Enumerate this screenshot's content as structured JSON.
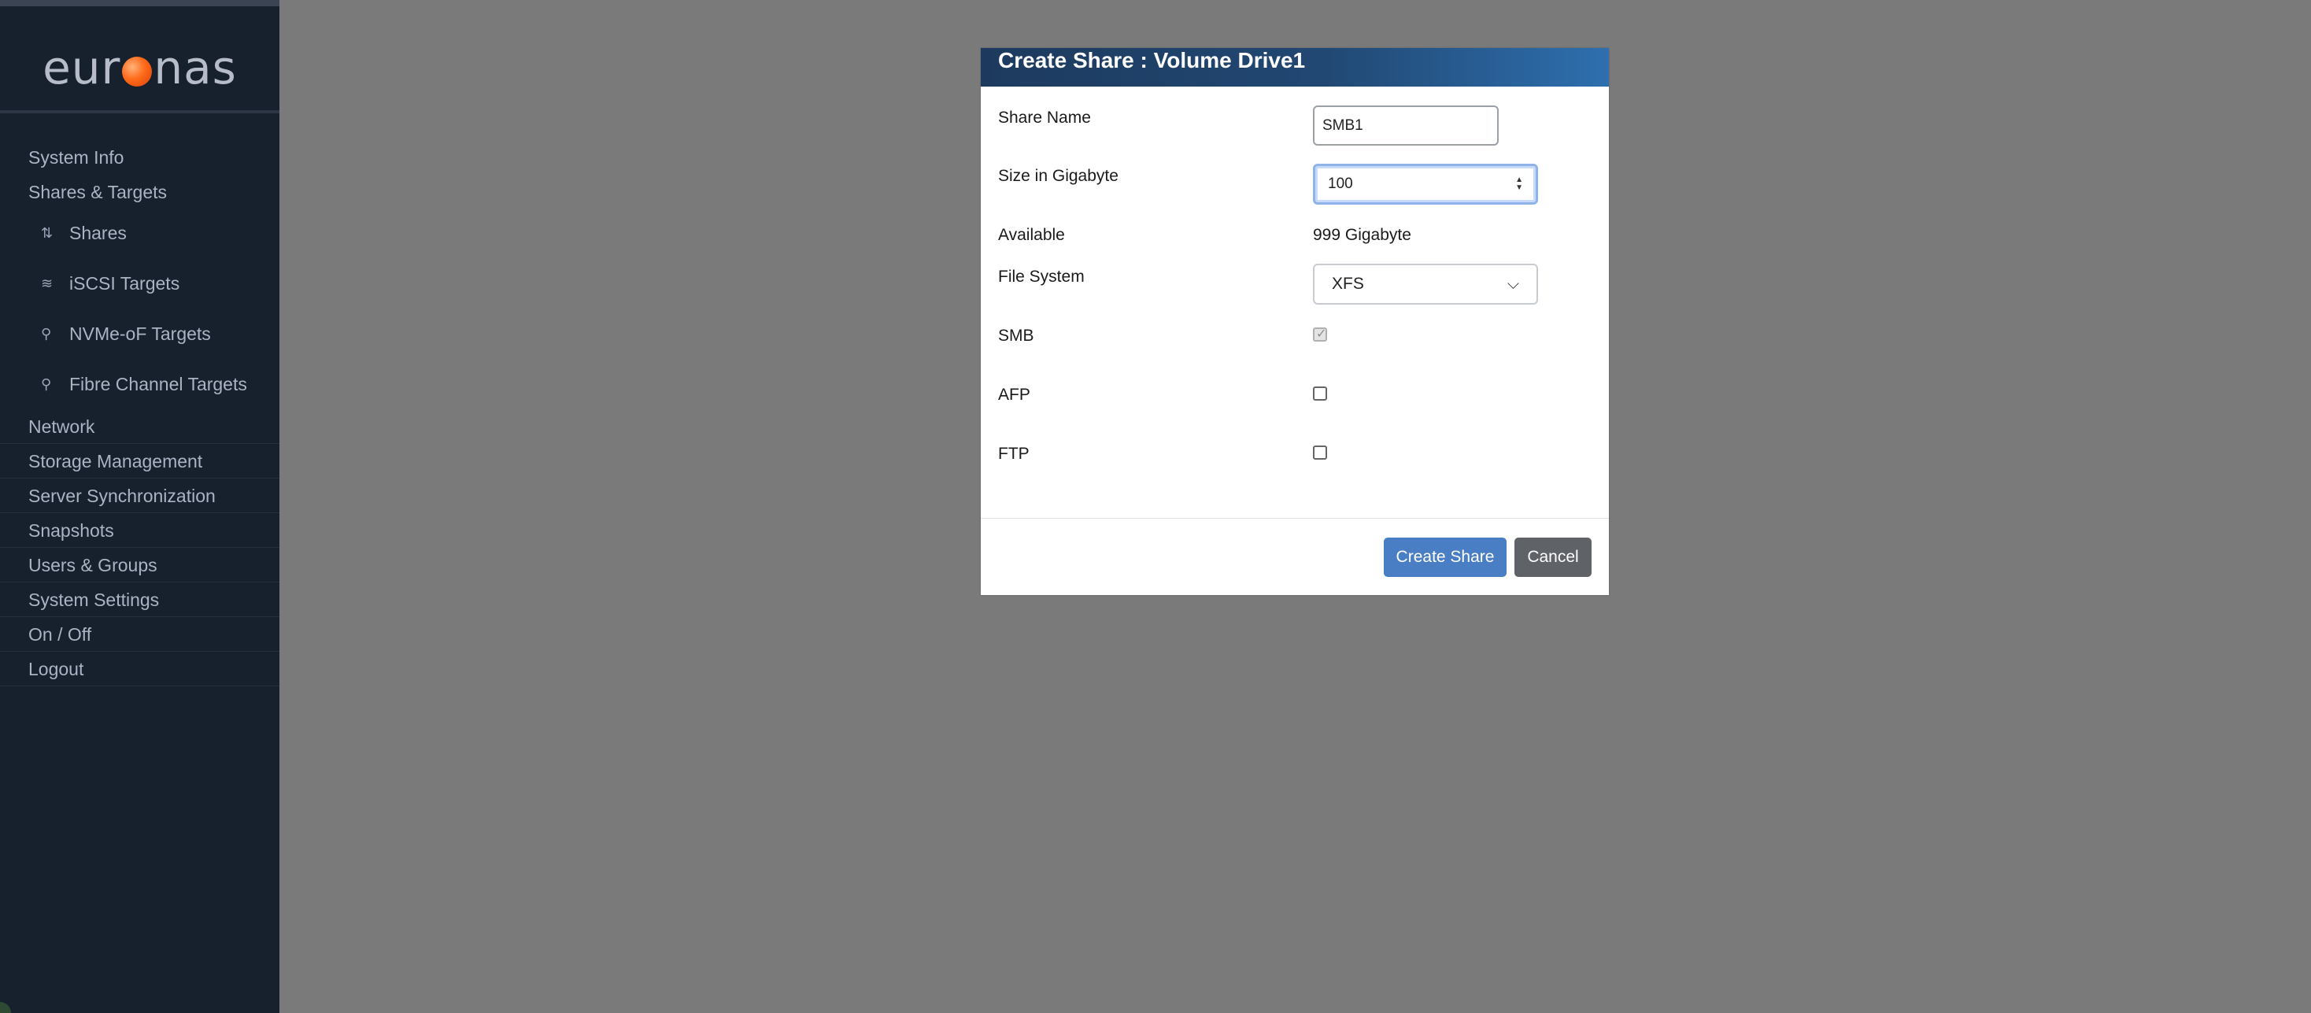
{
  "sidebar": {
    "logo_left": "eur",
    "logo_right": "nas",
    "items": [
      {
        "label": "System Info"
      },
      {
        "label": "Shares & Targets"
      }
    ],
    "sub_items": [
      {
        "label": "Shares",
        "icon": "sort-icon"
      },
      {
        "label": "iSCSI Targets",
        "icon": "layers-icon"
      },
      {
        "label": "NVMe-oF Targets",
        "icon": "network-icon"
      },
      {
        "label": "Fibre Channel Targets",
        "icon": "network-icon"
      }
    ],
    "items_after": [
      {
        "label": "Network"
      },
      {
        "label": "Storage Management"
      },
      {
        "label": "Server Synchronization"
      },
      {
        "label": "Snapshots"
      },
      {
        "label": "Users & Groups"
      },
      {
        "label": "System Settings"
      },
      {
        "label": "On / Off"
      },
      {
        "label": "Logout"
      }
    ]
  },
  "modal": {
    "title": "Create Share : Volume Drive1",
    "fields": {
      "share_name_label": "Share Name",
      "share_name_value": "SMB1",
      "size_label": "Size in Gigabyte",
      "size_value": "100",
      "available_label": "Available",
      "available_value": "999 Gigabyte",
      "filesystem_label": "File System",
      "filesystem_value": "XFS",
      "smb_label": "SMB",
      "afp_label": "AFP",
      "ftp_label": "FTP"
    },
    "checkboxes": {
      "smb": true,
      "afp": false,
      "ftp": false
    },
    "buttons": {
      "create": "Create Share",
      "cancel": "Cancel"
    }
  },
  "colors": {
    "sidebar_bg": "#17202d",
    "overlay": "#7a7a7a",
    "primary_button": "#4a7ec4",
    "secondary_button": "#5f6368"
  }
}
